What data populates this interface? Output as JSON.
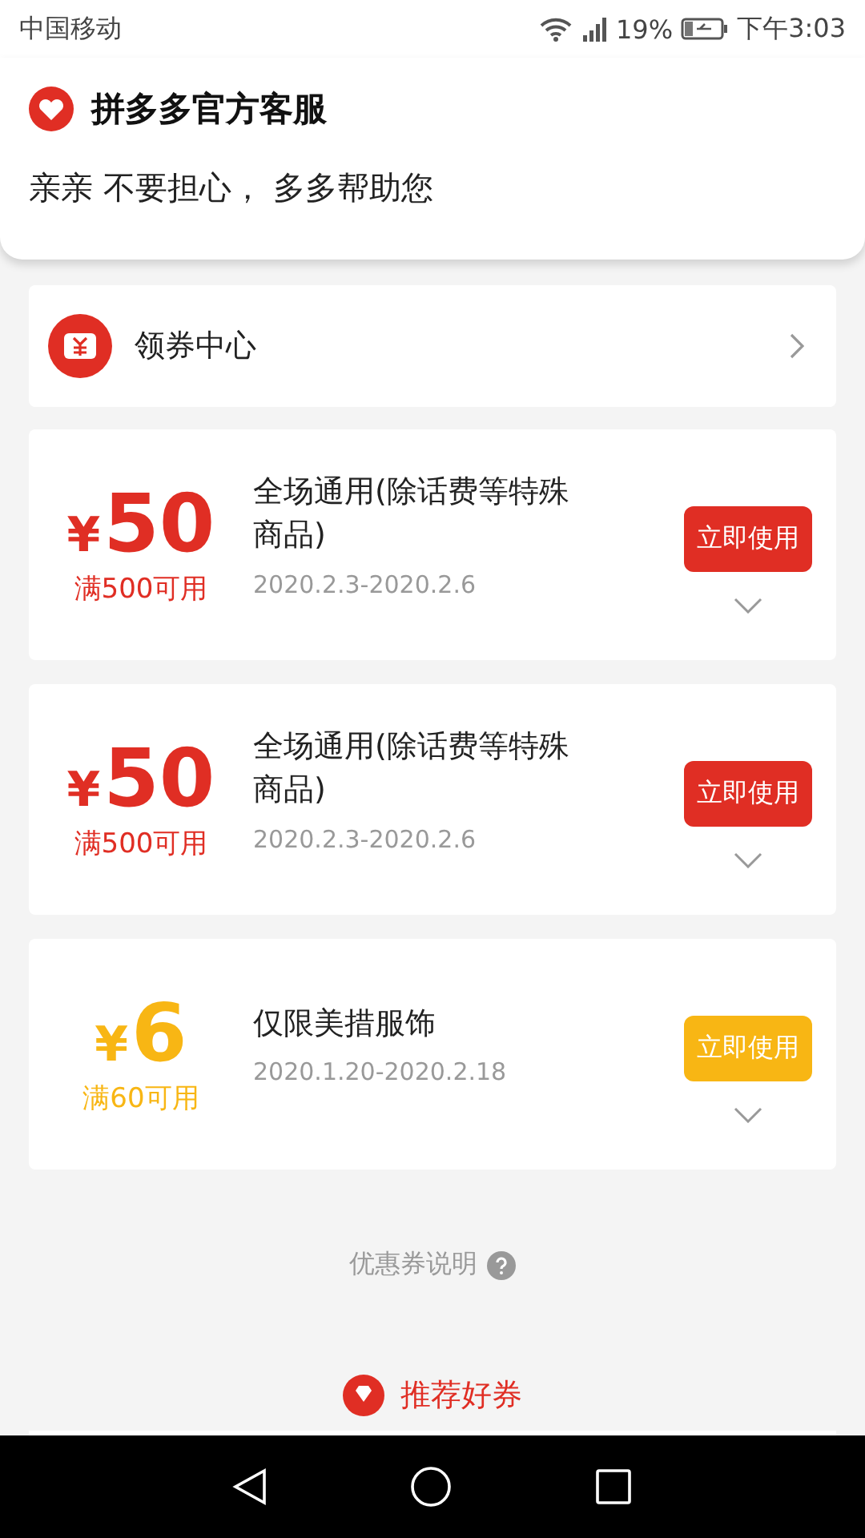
{
  "status_bar": {
    "carrier": "中国移动",
    "battery": "19%",
    "time": "下午3:03"
  },
  "notification": {
    "app": "拼多多官方客服",
    "message": "亲亲 不要担心， 多多帮助您"
  },
  "coupon_center": {
    "label": "领券中心"
  },
  "coupons": [
    {
      "amount": "50",
      "currency": "¥",
      "condition": "满500可用",
      "title": "全场通用(除话费等特殊商品)",
      "dates": "2020.2.3-2020.2.6",
      "action": "立即使用",
      "color": "#e02e24"
    },
    {
      "amount": "50",
      "currency": "¥",
      "condition": "满500可用",
      "title": "全场通用(除话费等特殊商品)",
      "dates": "2020.2.3-2020.2.6",
      "action": "立即使用",
      "color": "#e02e24"
    },
    {
      "amount": "6",
      "currency": "¥",
      "condition": "满60可用",
      "title": "仅限美措服饰",
      "dates": "2020.1.20-2020.2.18",
      "action": "立即使用",
      "color": "#f8b614"
    }
  ],
  "help_link": "优惠券说明",
  "recommend": "推荐好券"
}
